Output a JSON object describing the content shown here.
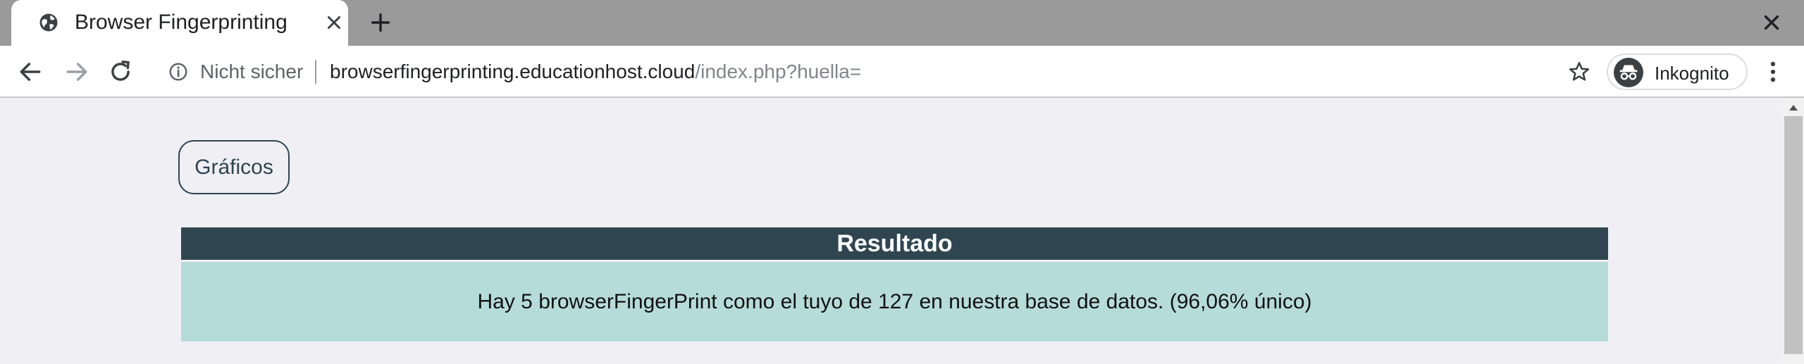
{
  "browser": {
    "tab": {
      "title": "Browser Fingerprinting"
    },
    "omnibox": {
      "security_label": "Nicht sicher",
      "url_host": "browserfingerprinting.educationhost.cloud",
      "url_path": "/index.php?huella="
    },
    "profile": {
      "label": "Inkognito"
    },
    "icons": {
      "favicon": "globe-icon",
      "tab_close": "close-icon",
      "new_tab": "plus-icon",
      "back": "arrow-left-icon",
      "forward": "arrow-right-icon",
      "reload": "reload-icon",
      "info": "info-icon",
      "bookmark": "star-icon",
      "incognito": "incognito-icon",
      "menu": "kebab-menu-icon",
      "window_close": "close-icon"
    }
  },
  "page": {
    "graficos_button": "Gráficos",
    "result_header": "Resultado",
    "result_text": "Hay 5 browserFingerPrint como el tuyo de 127 en nuestra base de datos. (96,06% único)"
  },
  "colors": {
    "header_bg": "#2f4651",
    "result_bg": "#b6dcda",
    "page_bg": "#efeff4",
    "tabstrip_bg": "#9a9a9a"
  }
}
